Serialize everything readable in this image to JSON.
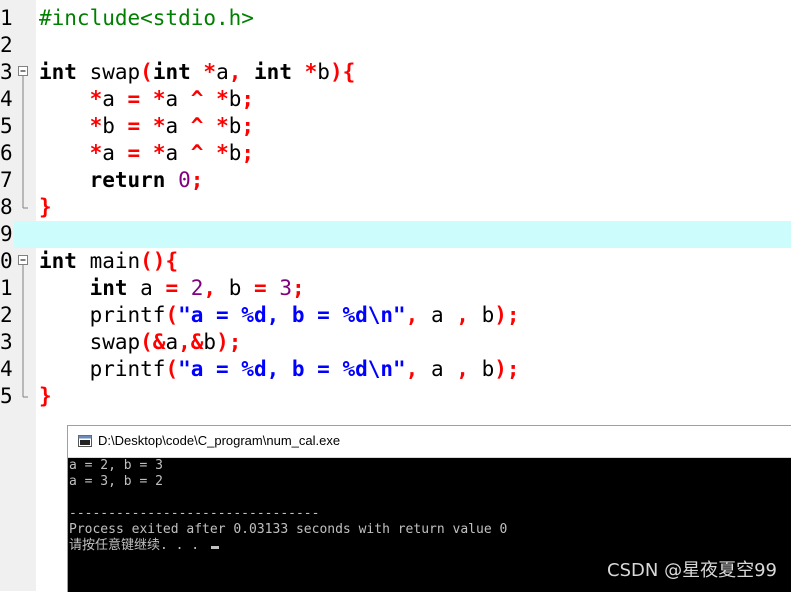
{
  "editor": {
    "lines": [
      {
        "num": "1",
        "tokens": [
          {
            "t": "#include<stdio.h>",
            "c": "pre"
          }
        ]
      },
      {
        "num": "2",
        "tokens": []
      },
      {
        "num": "3",
        "fold": "open",
        "tokens": [
          {
            "t": "int",
            "c": "kw"
          },
          {
            "t": " swap",
            "c": "plain"
          },
          {
            "t": "(",
            "c": "op"
          },
          {
            "t": "int",
            "c": "kw"
          },
          {
            "t": " ",
            "c": "plain"
          },
          {
            "t": "*",
            "c": "op"
          },
          {
            "t": "a",
            "c": "plain"
          },
          {
            "t": ",",
            "c": "op"
          },
          {
            "t": " ",
            "c": "plain"
          },
          {
            "t": "int",
            "c": "kw"
          },
          {
            "t": " ",
            "c": "plain"
          },
          {
            "t": "*",
            "c": "op"
          },
          {
            "t": "b",
            "c": "plain"
          },
          {
            "t": "){",
            "c": "op"
          }
        ]
      },
      {
        "num": "4",
        "fold": "line",
        "tokens": [
          {
            "t": "    ",
            "c": "plain"
          },
          {
            "t": "*",
            "c": "op"
          },
          {
            "t": "a",
            "c": "plain"
          },
          {
            "t": " = ",
            "c": "op"
          },
          {
            "t": "*",
            "c": "op"
          },
          {
            "t": "a",
            "c": "plain"
          },
          {
            "t": " ^ ",
            "c": "op"
          },
          {
            "t": "*",
            "c": "op"
          },
          {
            "t": "b",
            "c": "plain"
          },
          {
            "t": ";",
            "c": "op"
          }
        ]
      },
      {
        "num": "5",
        "fold": "line",
        "tokens": [
          {
            "t": "    ",
            "c": "plain"
          },
          {
            "t": "*",
            "c": "op"
          },
          {
            "t": "b",
            "c": "plain"
          },
          {
            "t": " = ",
            "c": "op"
          },
          {
            "t": "*",
            "c": "op"
          },
          {
            "t": "a",
            "c": "plain"
          },
          {
            "t": " ^ ",
            "c": "op"
          },
          {
            "t": "*",
            "c": "op"
          },
          {
            "t": "b",
            "c": "plain"
          },
          {
            "t": ";",
            "c": "op"
          }
        ]
      },
      {
        "num": "6",
        "fold": "line",
        "tokens": [
          {
            "t": "    ",
            "c": "plain"
          },
          {
            "t": "*",
            "c": "op"
          },
          {
            "t": "a",
            "c": "plain"
          },
          {
            "t": " = ",
            "c": "op"
          },
          {
            "t": "*",
            "c": "op"
          },
          {
            "t": "a",
            "c": "plain"
          },
          {
            "t": " ^ ",
            "c": "op"
          },
          {
            "t": "*",
            "c": "op"
          },
          {
            "t": "b",
            "c": "plain"
          },
          {
            "t": ";",
            "c": "op"
          }
        ]
      },
      {
        "num": "7",
        "fold": "line",
        "tokens": [
          {
            "t": "    ",
            "c": "plain"
          },
          {
            "t": "return",
            "c": "kw"
          },
          {
            "t": " ",
            "c": "plain"
          },
          {
            "t": "0",
            "c": "num"
          },
          {
            "t": ";",
            "c": "op"
          }
        ]
      },
      {
        "num": "8",
        "fold": "end",
        "tokens": [
          {
            "t": "}",
            "c": "op"
          }
        ]
      },
      {
        "num": "9",
        "current": true,
        "tokens": []
      },
      {
        "num": "0",
        "fold": "open",
        "tokens": [
          {
            "t": "int",
            "c": "kw"
          },
          {
            "t": " main",
            "c": "plain"
          },
          {
            "t": "(){",
            "c": "op"
          }
        ]
      },
      {
        "num": "1",
        "fold": "line",
        "tokens": [
          {
            "t": "    ",
            "c": "plain"
          },
          {
            "t": "int",
            "c": "kw"
          },
          {
            "t": " a ",
            "c": "plain"
          },
          {
            "t": "=",
            "c": "op"
          },
          {
            "t": " ",
            "c": "plain"
          },
          {
            "t": "2",
            "c": "num"
          },
          {
            "t": ",",
            "c": "op"
          },
          {
            "t": " b ",
            "c": "plain"
          },
          {
            "t": "=",
            "c": "op"
          },
          {
            "t": " ",
            "c": "plain"
          },
          {
            "t": "3",
            "c": "num"
          },
          {
            "t": ";",
            "c": "op"
          }
        ]
      },
      {
        "num": "2",
        "fold": "line",
        "tokens": [
          {
            "t": "    printf",
            "c": "plain"
          },
          {
            "t": "(",
            "c": "op"
          },
          {
            "t": "\"a = %d, b = %d\\n\"",
            "c": "str"
          },
          {
            "t": ",",
            "c": "op"
          },
          {
            "t": " a ",
            "c": "plain"
          },
          {
            "t": ",",
            "c": "op"
          },
          {
            "t": " b",
            "c": "plain"
          },
          {
            "t": ");",
            "c": "op"
          }
        ]
      },
      {
        "num": "3",
        "fold": "line",
        "tokens": [
          {
            "t": "    swap",
            "c": "plain"
          },
          {
            "t": "(&",
            "c": "op"
          },
          {
            "t": "a",
            "c": "plain"
          },
          {
            "t": ",&",
            "c": "op"
          },
          {
            "t": "b",
            "c": "plain"
          },
          {
            "t": ");",
            "c": "op"
          }
        ]
      },
      {
        "num": "4",
        "fold": "line",
        "tokens": [
          {
            "t": "    printf",
            "c": "plain"
          },
          {
            "t": "(",
            "c": "op"
          },
          {
            "t": "\"a = %d, b = %d\\n\"",
            "c": "str"
          },
          {
            "t": ",",
            "c": "op"
          },
          {
            "t": " a ",
            "c": "plain"
          },
          {
            "t": ",",
            "c": "op"
          },
          {
            "t": " b",
            "c": "plain"
          },
          {
            "t": ");",
            "c": "op"
          }
        ]
      },
      {
        "num": "5",
        "fold": "end",
        "tokens": [
          {
            "t": "}",
            "c": "op"
          }
        ]
      }
    ]
  },
  "console": {
    "title": "D:\\Desktop\\code\\C_program\\num_cal.exe",
    "output": [
      "a = 2, b = 3",
      "a = 3, b = 2",
      "",
      "--------------------------------",
      "Process exited after 0.03133 seconds with return value 0",
      "请按任意键继续. . . "
    ]
  },
  "watermark": "CSDN @星夜夏空99",
  "colors": {
    "current_line": "#ccfcfb",
    "keyword": "#000000",
    "operator": "#ff0000",
    "string": "#0000ff",
    "number": "#800080",
    "preprocessor": "#008000"
  }
}
